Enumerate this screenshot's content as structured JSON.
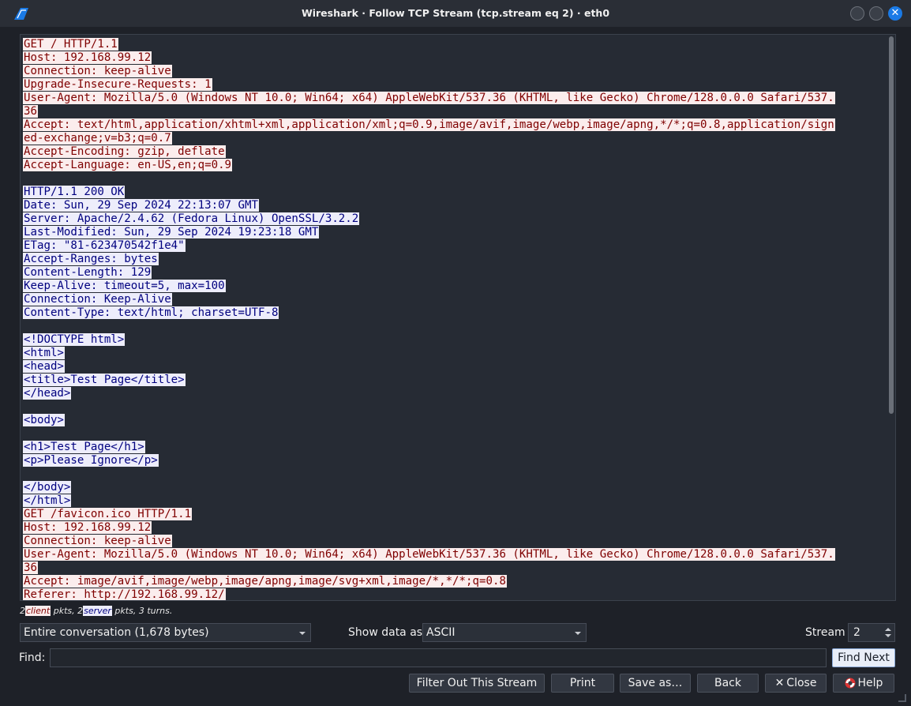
{
  "window": {
    "title": "Wireshark · Follow TCP Stream (tcp.stream eq 2) · eth0",
    "close_glyph": "✕"
  },
  "stream": {
    "lines": [
      {
        "dir": "client",
        "text": "GET / HTTP/1.1"
      },
      {
        "dir": "client",
        "text": "Host: 192.168.99.12"
      },
      {
        "dir": "client",
        "text": "Connection: keep-alive"
      },
      {
        "dir": "client",
        "text": "Upgrade-Insecure-Requests: 1"
      },
      {
        "dir": "client",
        "text": "User-Agent: Mozilla/5.0 (Windows NT 10.0; Win64; x64) AppleWebKit/537.36 (KHTML, like Gecko) Chrome/128.0.0.0 Safari/537."
      },
      {
        "dir": "client",
        "text": "36"
      },
      {
        "dir": "client",
        "text": "Accept: text/html,application/xhtml+xml,application/xml;q=0.9,image/avif,image/webp,image/apng,*/*;q=0.8,application/sign"
      },
      {
        "dir": "client",
        "text": "ed-exchange;v=b3;q=0.7"
      },
      {
        "dir": "client",
        "text": "Accept-Encoding: gzip, deflate"
      },
      {
        "dir": "client",
        "text": "Accept-Language: en-US,en;q=0.9"
      },
      {
        "dir": "blank",
        "text": ""
      },
      {
        "dir": "server",
        "text": "HTTP/1.1 200 OK"
      },
      {
        "dir": "server",
        "text": "Date: Sun, 29 Sep 2024 22:13:07 GMT"
      },
      {
        "dir": "server",
        "text": "Server: Apache/2.4.62 (Fedora Linux) OpenSSL/3.2.2"
      },
      {
        "dir": "server",
        "text": "Last-Modified: Sun, 29 Sep 2024 19:23:18 GMT"
      },
      {
        "dir": "server",
        "text": "ETag: \"81-623470542f1e4\""
      },
      {
        "dir": "server",
        "text": "Accept-Ranges: bytes"
      },
      {
        "dir": "server",
        "text": "Content-Length: 129"
      },
      {
        "dir": "server",
        "text": "Keep-Alive: timeout=5, max=100"
      },
      {
        "dir": "server",
        "text": "Connection: Keep-Alive"
      },
      {
        "dir": "server",
        "text": "Content-Type: text/html; charset=UTF-8"
      },
      {
        "dir": "blank",
        "text": ""
      },
      {
        "dir": "server",
        "text": "<!DOCTYPE html>"
      },
      {
        "dir": "server",
        "text": "<html>"
      },
      {
        "dir": "server",
        "text": "<head>"
      },
      {
        "dir": "server",
        "text": "<title>Test Page</title>"
      },
      {
        "dir": "server",
        "text": "</head>"
      },
      {
        "dir": "blank",
        "text": ""
      },
      {
        "dir": "server",
        "text": "<body>"
      },
      {
        "dir": "blank",
        "text": ""
      },
      {
        "dir": "server",
        "text": "<h1>Test Page</h1>"
      },
      {
        "dir": "server",
        "text": "<p>Please Ignore</p>"
      },
      {
        "dir": "blank",
        "text": ""
      },
      {
        "dir": "server",
        "text": "</body>"
      },
      {
        "dir": "server",
        "text": "</html>"
      },
      {
        "dir": "client",
        "text": "GET /favicon.ico HTTP/1.1"
      },
      {
        "dir": "client",
        "text": "Host: 192.168.99.12"
      },
      {
        "dir": "client",
        "text": "Connection: keep-alive"
      },
      {
        "dir": "client",
        "text": "User-Agent: Mozilla/5.0 (Windows NT 10.0; Win64; x64) AppleWebKit/537.36 (KHTML, like Gecko) Chrome/128.0.0.0 Safari/537."
      },
      {
        "dir": "client",
        "text": "36"
      },
      {
        "dir": "client",
        "text": "Accept: image/avif,image/webp,image/apng,image/svg+xml,image/*,*/*;q=0.8"
      },
      {
        "dir": "client",
        "text": "Referer: http://192.168.99.12/"
      }
    ],
    "colors": {
      "client_bg": "#fbeded",
      "client_fg": "#7f0000",
      "server_bg": "#ededfb",
      "server_fg": "#00007f"
    }
  },
  "summary": {
    "client_count": "2",
    "client_label": "client",
    "mid": " pkts, 2",
    "server_label": "server",
    "tail": " pkts, 3 turns."
  },
  "controls": {
    "conversation_value": "Entire conversation (1,678 bytes)",
    "show_data_label": "Show data as",
    "show_data_value": "ASCII",
    "stream_label": "Stream",
    "stream_value": "2",
    "find_label": "Find:",
    "find_value": "",
    "find_next_label": "Find Next"
  },
  "buttons": {
    "filter_out": "Filter Out This Stream",
    "print": "Print",
    "save_as": "Save as…",
    "back": "Back",
    "close": "Close",
    "help": "Help"
  },
  "icons": [
    "wireshark-fin-icon",
    "minimize-icon",
    "maximize-icon",
    "close-icon",
    "chevron-down-icon",
    "spin-up-icon",
    "spin-down-icon",
    "close-x-icon",
    "lifebuoy-help-icon"
  ]
}
